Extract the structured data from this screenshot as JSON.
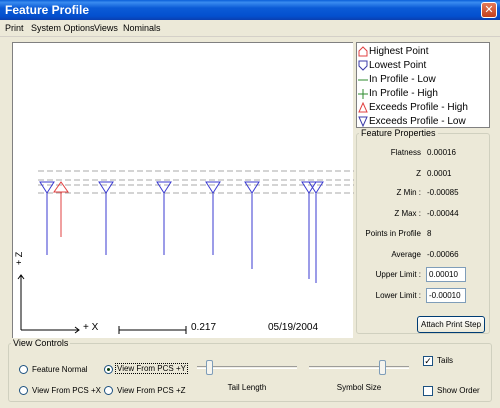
{
  "window": {
    "title": "Feature Profile",
    "close_glyph": "✕"
  },
  "menu": {
    "items": [
      "Print",
      "System Options",
      "Views",
      "Nominals"
    ]
  },
  "canvas": {
    "x_axis_label": "+ X",
    "z_axis_label": "+ Z",
    "scale_value": "0.217",
    "date": "05/19/2004"
  },
  "legend": {
    "items": [
      {
        "label": "Highest Point",
        "icon": "pentagon-up-icon",
        "color": "#e04040"
      },
      {
        "label": "Lowest Point",
        "icon": "pentagon-down-icon",
        "color": "#3a3aa8"
      },
      {
        "label": "In Profile - Low",
        "icon": "dash-icon",
        "color": "#2e8b2e"
      },
      {
        "label": "In Profile - High",
        "icon": "plus-icon",
        "color": "#2e8b2e"
      },
      {
        "label": "Exceeds Profile - High",
        "icon": "triangle-up-icon",
        "color": "#e04040"
      },
      {
        "label": "Exceeds Profile - Low",
        "icon": "triangle-down-icon",
        "color": "#3a3aa8"
      }
    ]
  },
  "feature_properties": {
    "group_label": "Feature Properties",
    "flatness": {
      "label": "Flatness",
      "value": "0.00016"
    },
    "z": {
      "label": "Z",
      "value": "0.0001"
    },
    "z_min": {
      "label": "Z Min :",
      "value": "-0.00085"
    },
    "z_max": {
      "label": "Z Max :",
      "value": "-0.00044"
    },
    "points_in_profile": {
      "label": "Points in Profile",
      "value": "8"
    },
    "average": {
      "label": "Average",
      "value": "-0.00066"
    },
    "upper_limit": {
      "label": "Upper Limit :",
      "value": "0.00010"
    },
    "lower_limit": {
      "label": "Lower Limit :",
      "value": "-0.00010"
    },
    "attach_button": "Attach Print Step"
  },
  "view_controls": {
    "group_label": "View Controls",
    "options": {
      "feature_normal": "Feature Normal",
      "view_pcs_y": "View From PCS +Y",
      "view_pcs_x": "View From PCS +X",
      "view_pcs_z": "View From PCS +Z"
    },
    "selected": "view_pcs_y",
    "tail_length": {
      "label": "Tail Length",
      "value": 0.1
    },
    "symbol_size": {
      "label": "Symbol Size",
      "value": 0.75
    },
    "tails": {
      "label": "Tails",
      "checked": true
    },
    "show_order": {
      "label": "Show Order",
      "checked": false
    }
  },
  "colors": {
    "profile_blue": "#3a3ad0",
    "highest_red": "#e04040",
    "limit_gray": "#a0a0a0"
  }
}
